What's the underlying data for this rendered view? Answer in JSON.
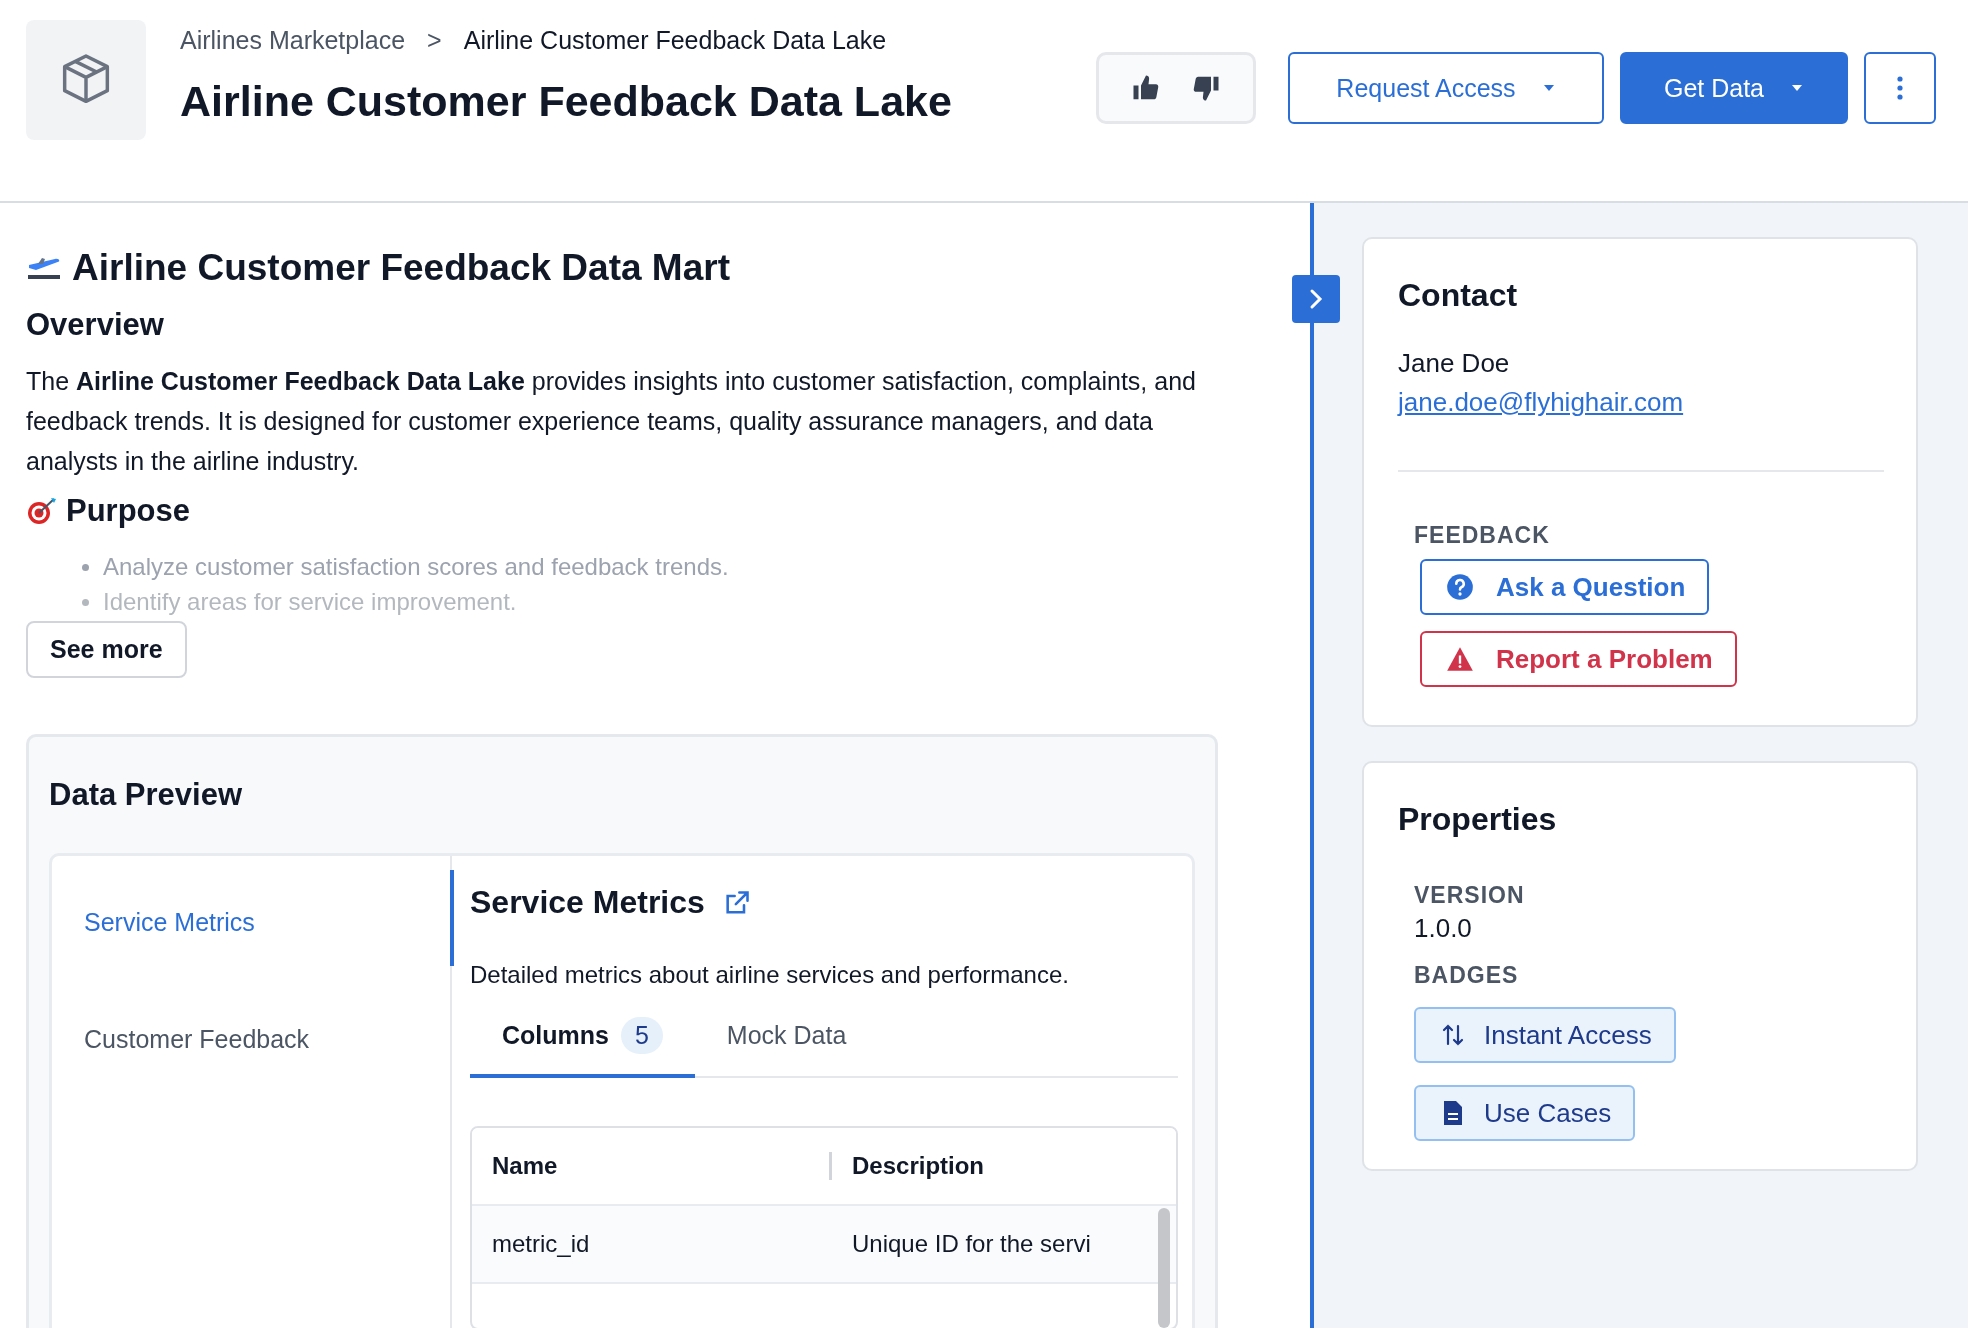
{
  "header": {
    "breadcrumb": [
      "Airlines Marketplace",
      "Airline Customer Feedback Data Lake"
    ],
    "breadcrumb_separator": ">",
    "title": "Airline Customer Feedback Data Lake",
    "actions": [
      {
        "label": "Request Access",
        "kind": "outline"
      },
      {
        "label": "Get Data",
        "kind": "primary"
      }
    ]
  },
  "main": {
    "title": "Airline Customer Feedback Data Mart",
    "overview": {
      "heading": "Overview",
      "text": "The **Airline Customer Feedback Data Lake** provides insights into customer satisfaction, complaints, and feedback trends. It is designed for customer experience teams, quality assurance managers, and data analysts in the airline industry."
    },
    "purpose": {
      "heading": "Purpose",
      "items": [
        "Analyze customer satisfaction scores and feedback trends.",
        "Identify areas for service improvement."
      ]
    },
    "see_more": "See more",
    "data_preview": {
      "heading": "Data Preview",
      "tables": [
        {
          "label": "Service Metrics",
          "selected": true
        },
        {
          "label": "Customer Feedback",
          "selected": false
        }
      ],
      "detail": {
        "title": "Service Metrics",
        "description": "Detailed metrics about airline services and performance.",
        "tabs": [
          {
            "label": "Columns",
            "count": "5",
            "selected": true
          },
          {
            "label": "Mock Data",
            "selected": false
          }
        ],
        "table": {
          "columns": [
            "Name",
            "Description"
          ],
          "rows": [
            [
              "metric_id",
              "Unique ID for the servi"
            ]
          ]
        }
      }
    }
  },
  "sidebar": {
    "contact": {
      "heading": "Contact",
      "name": "Jane Doe",
      "email": "jane.doe@flyhighair.com",
      "feedback_label": "FEEDBACK",
      "feedback_buttons": [
        {
          "label": "Ask a Question",
          "kind": "question"
        },
        {
          "label": "Report a Problem",
          "kind": "problem"
        }
      ]
    },
    "properties": {
      "heading": "Properties",
      "version_label": "VERSION",
      "version": "1.0.0",
      "badges_label": "BADGES",
      "badges": [
        {
          "label": "Instant Access",
          "kind": "access"
        },
        {
          "label": "Use Cases",
          "kind": "document"
        }
      ]
    }
  }
}
